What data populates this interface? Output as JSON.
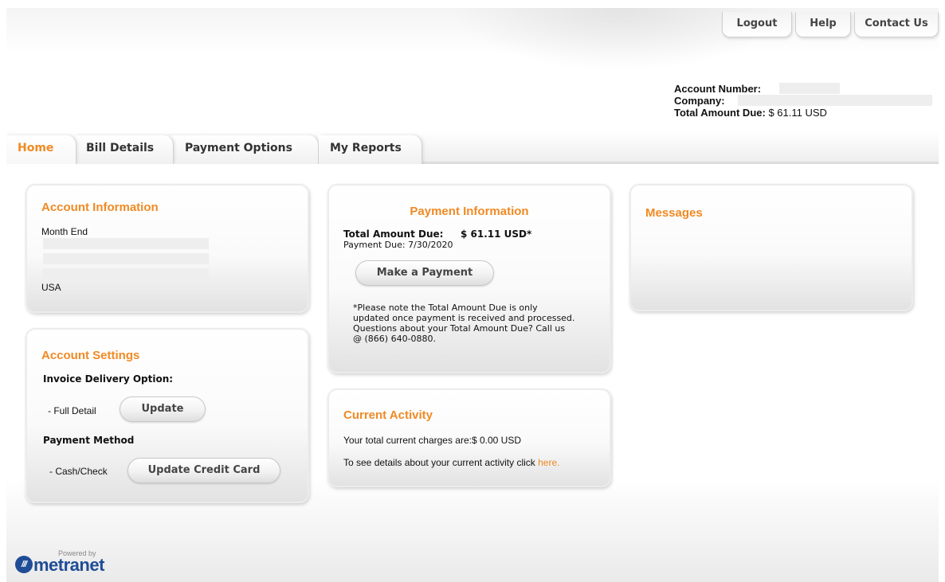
{
  "top_links": {
    "logout": "Logout",
    "help": "Help",
    "contact_us": "Contact Us"
  },
  "account_summary": {
    "account_number_label": "Account Number:",
    "company_label": "Company:",
    "total_amount_due_label": "Total Amount Due:",
    "total_amount_due_value": "$ 61.11 USD"
  },
  "tabs": [
    "Home",
    "Bill Details",
    "Payment Options",
    "My Reports"
  ],
  "account_information": {
    "title": "Account Information",
    "month_end": "Month End",
    "country": "USA"
  },
  "account_settings": {
    "title": "Account Settings",
    "invoice_delivery_label": "Invoice Delivery Option:",
    "invoice_delivery_value": "- Full Detail",
    "update_button": "Update",
    "payment_method_label": "Payment Method",
    "payment_method_value": "- Cash/Check",
    "update_credit_card_button": "Update Credit Card"
  },
  "payment_information": {
    "title": "Payment Information",
    "total_label": "Total Amount Due:",
    "total_value": "$ 61.11 USD*",
    "payment_due": "Payment Due: 7/30/2020",
    "make_payment_button": "Make a Payment",
    "note_lines": [
      "*Please note the Total Amount Due is only",
      "updated once payment is received and processed.",
      "Questions about your Total Amount Due? Call us",
      "@ (866) 640-0880."
    ]
  },
  "current_activity": {
    "title": "Current Activity",
    "charges_text": "Your total current charges are:$ 0.00 USD",
    "details_text": "To see details about your current activity click ",
    "details_link": "here",
    "details_end": "."
  },
  "messages": {
    "title": "Messages"
  },
  "footer": {
    "powered_by": "Powered by",
    "logo_mark": "///",
    "logo_text": "metranet"
  },
  "colors": {
    "accent": "#f08a24",
    "brand_blue": "#1f4c96"
  }
}
